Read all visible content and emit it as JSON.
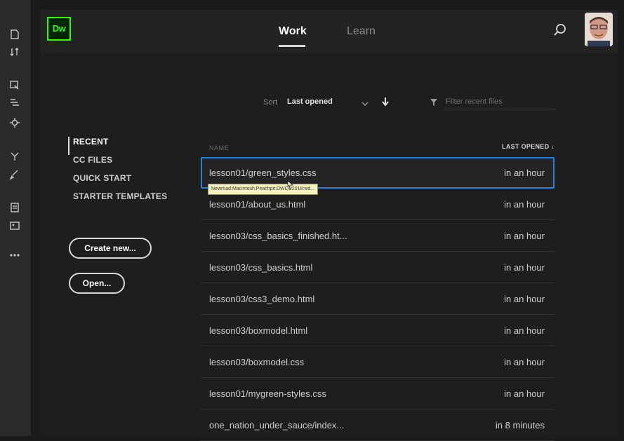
{
  "app": {
    "logo_text": "Dw"
  },
  "nav": {
    "tabs": [
      {
        "label": "Work"
      },
      {
        "label": "Learn"
      }
    ]
  },
  "sort": {
    "label": "Sort",
    "value": "Last opened"
  },
  "filter": {
    "placeholder": "Filter recent files"
  },
  "side_menu": {
    "items": [
      {
        "label": "RECENT"
      },
      {
        "label": "CC FILES"
      },
      {
        "label": "QUICK START"
      },
      {
        "label": "STARTER TEMPLATES"
      }
    ],
    "create_label": "Create new...",
    "open_label": "Open..."
  },
  "file_list": {
    "col_name": "NAME",
    "col_last_opened": "LAST OPENED ↓",
    "tooltip": "Newroad:Macintosh:Peachpit:DWCC2018:wd...",
    "files": [
      {
        "name": "lesson01/green_styles.css",
        "time": "in an hour"
      },
      {
        "name": "lesson01/about_us.html",
        "time": "in an hour"
      },
      {
        "name": "lesson03/css_basics_finished.ht...",
        "time": "in an hour"
      },
      {
        "name": "lesson03/css_basics.html",
        "time": "in an hour"
      },
      {
        "name": "lesson03/css3_demo.html",
        "time": "in an hour"
      },
      {
        "name": "lesson03/boxmodel.html",
        "time": "in an hour"
      },
      {
        "name": "lesson03/boxmodel.css",
        "time": "in an hour"
      },
      {
        "name": "lesson01/mygreen-styles.css",
        "time": "in an hour"
      },
      {
        "name": "one_nation_under_sauce/index...",
        "time": "in 8 minutes"
      }
    ]
  },
  "colors": {
    "accent": "#2d7fd3",
    "logo_green": "#35fa00",
    "tooltip_bg": "#f7f4bf"
  }
}
